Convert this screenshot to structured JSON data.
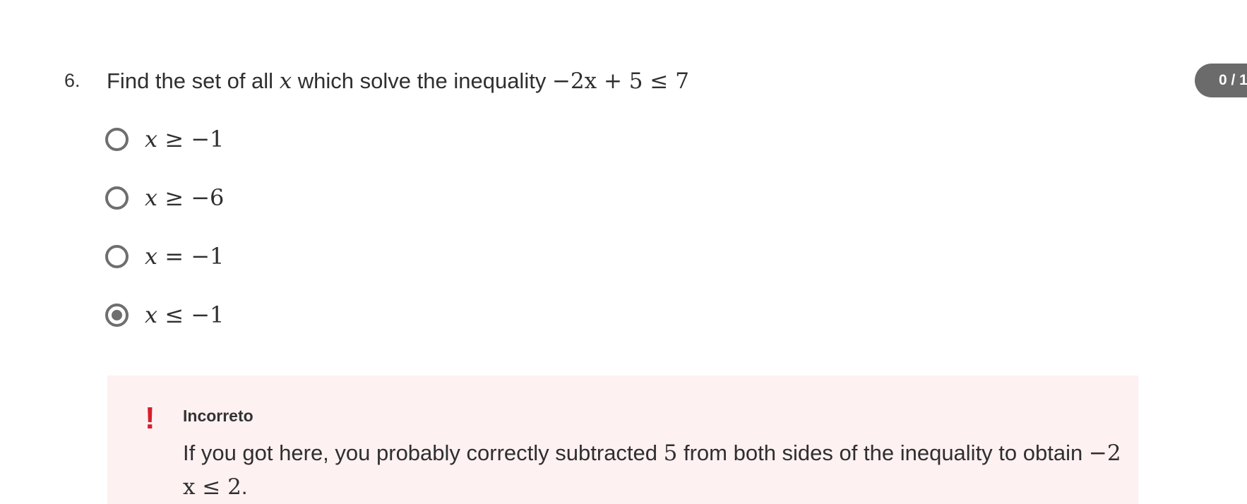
{
  "question": {
    "number": "6.",
    "text_before": "Find the set of all ",
    "variable": "x",
    "text_middle": " which solve the inequality ",
    "expression": "−2x + 5 ≤ 7"
  },
  "score": {
    "label": "0 / 1"
  },
  "options": [
    {
      "var": "x",
      "rest": " ≥ −1",
      "selected": false
    },
    {
      "var": "x",
      "rest": " ≥ −6",
      "selected": false
    },
    {
      "var": "x",
      "rest": " = −1",
      "selected": false
    },
    {
      "var": "x",
      "rest": " ≤ −1",
      "selected": true
    }
  ],
  "feedback": {
    "icon": "!",
    "icon_name": "exclamation-icon",
    "title": "Incorreto",
    "body_part1": "If you got here, you probably correctly subtracted ",
    "body_num": "5",
    "body_part2": " from both sides of the inequality to obtain ",
    "body_expr1": "−2",
    "body_expr2": "x ≤ 2",
    "body_end": ".",
    "background_color": "#fdf1f2",
    "icon_color": "#d81e2c"
  }
}
